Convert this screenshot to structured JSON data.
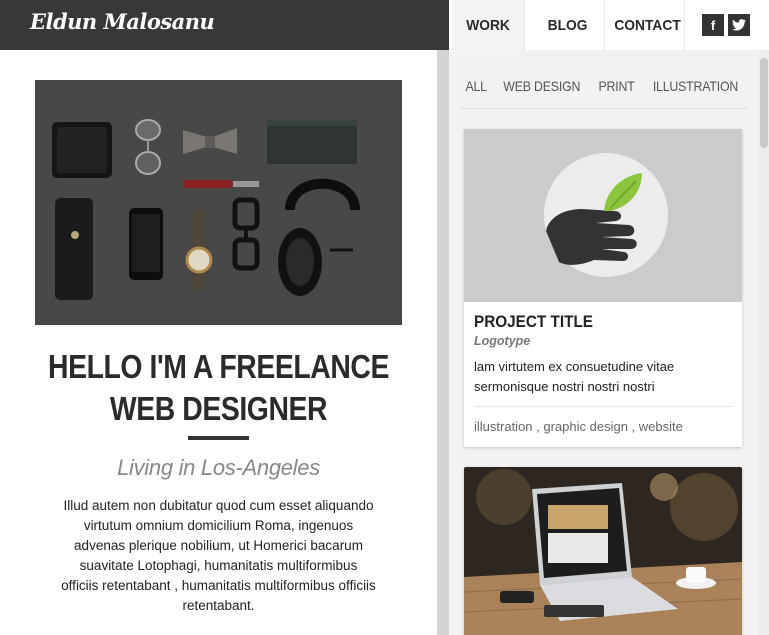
{
  "header": {
    "logo": "Eldun Malosanu",
    "nav": [
      {
        "label": "WORK"
      },
      {
        "label": "BLOG"
      },
      {
        "label": "CONTACT"
      }
    ],
    "social": [
      {
        "icon": "facebook-icon",
        "glyph": "f"
      },
      {
        "icon": "twitter-icon",
        "glyph": "t"
      }
    ]
  },
  "intro": {
    "headline_line1": "HELLO I'M A FREELANCE",
    "headline_line2": "WEB DESIGNER",
    "subtitle": "Living in Los-Angeles",
    "body": "Illud autem non dubitatur quod cum esset aliquando virtutum omnium domicilium Roma, ingenuos advenas plerique nobilium, ut Homerici bacarum suavitate Lotophagi, humanitatis multiformibus officiis retentabant , humanitatis multiformibus officiis retentabant."
  },
  "filters": [
    "ALL",
    "WEB DESIGN",
    "PRINT",
    "ILLUSTRATION"
  ],
  "projects": [
    {
      "title": "PROJECT TITLE",
      "category": "Logotype",
      "description": "lam virtutem ex consuetudine vitae sermonisque nostri nostri nostri",
      "tags": [
        "illustration",
        "graphic design",
        "website"
      ]
    }
  ],
  "colors": {
    "header_bg": "#383838",
    "accent_green": "#8cc63f",
    "text_dark": "#2b2b2b"
  }
}
